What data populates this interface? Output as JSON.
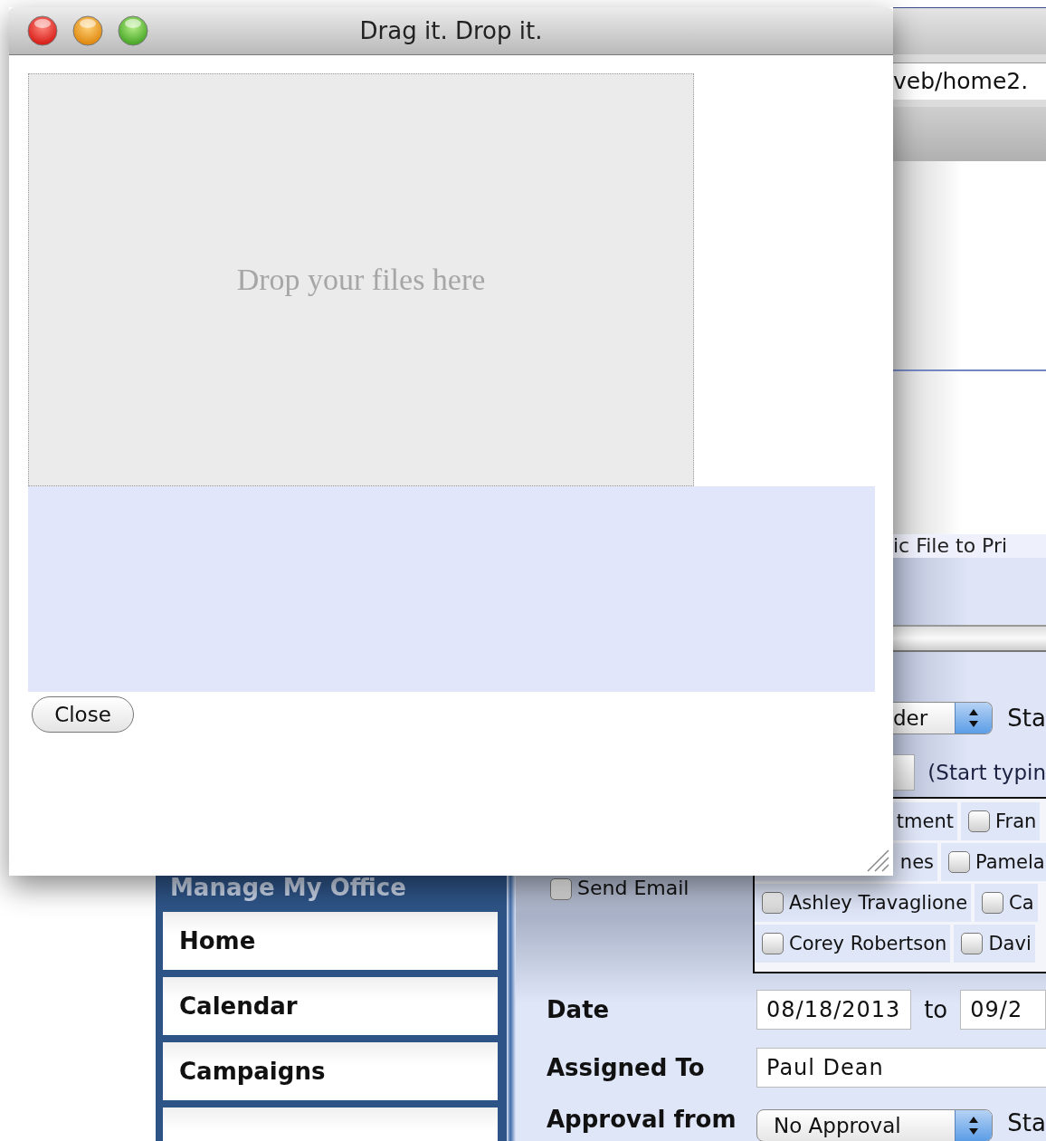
{
  "browser": {
    "address": "veb/home2."
  },
  "page": {
    "banner_text": "ic File to Pri",
    "order_select": {
      "value": "der"
    },
    "status_label": "Sta",
    "search_hint": "(Start typin",
    "send_email": {
      "label": "Send Email",
      "checked": false
    },
    "recipients": [
      [
        {
          "label": "tment"
        },
        {
          "label": "Fran",
          "checked": false
        }
      ],
      [
        {
          "label": "nes"
        },
        {
          "label": "Pamela",
          "checked": false
        }
      ],
      [
        {
          "label": "Ashley Travaglione",
          "checked": false
        },
        {
          "label": "Ca",
          "checked": false
        }
      ],
      [
        {
          "label": "Corey Robertson",
          "checked": false
        },
        {
          "label": "Davi",
          "checked": false
        }
      ]
    ]
  },
  "sidebar": {
    "title": "Manage My Office",
    "items": [
      {
        "label": "Home"
      },
      {
        "label": "Calendar"
      },
      {
        "label": "Campaigns"
      }
    ]
  },
  "form": {
    "date": {
      "label": "Date",
      "from": "08/18/2013",
      "between": "to",
      "to": "09/2"
    },
    "assigned_to": {
      "label": "Assigned To",
      "value": "Paul Dean"
    },
    "approval": {
      "label": "Approval from",
      "value": "No Approval",
      "status_label": "Sta"
    }
  },
  "dialog": {
    "title": "Drag it. Drop it.",
    "drop_prompt": "Drop your files here",
    "close_button": "Close"
  }
}
